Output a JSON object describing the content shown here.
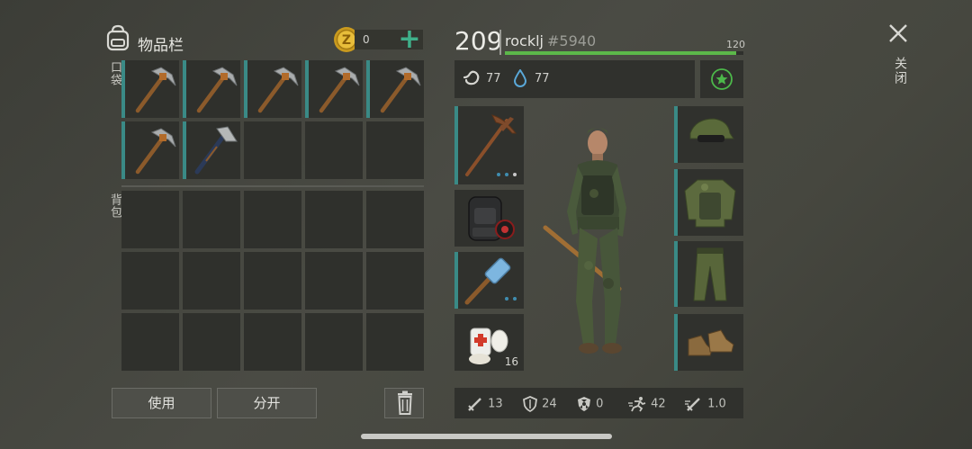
{
  "inventory": {
    "title": "物品栏",
    "coins": "0",
    "add_label": "+",
    "pocket_label": "口袋",
    "backpack_label": "背包"
  },
  "actions": {
    "use_label": "使用",
    "split_label": "分开"
  },
  "player": {
    "level": "209",
    "name": "rocklj",
    "tag": "#5940",
    "xp_max": "120",
    "xp_fraction": 0.97,
    "food": "77",
    "water": "77"
  },
  "equipment": {
    "medkit_count": "16"
  },
  "stats": {
    "attack": "13",
    "armor": "24",
    "radiation": "0",
    "speed": "42",
    "multiplier": "1.0"
  },
  "close": {
    "label": "关闭"
  },
  "colors": {
    "accent": "#3a8a86",
    "xp_bar": "#5cb84a",
    "add_icon": "#3fb08a"
  }
}
